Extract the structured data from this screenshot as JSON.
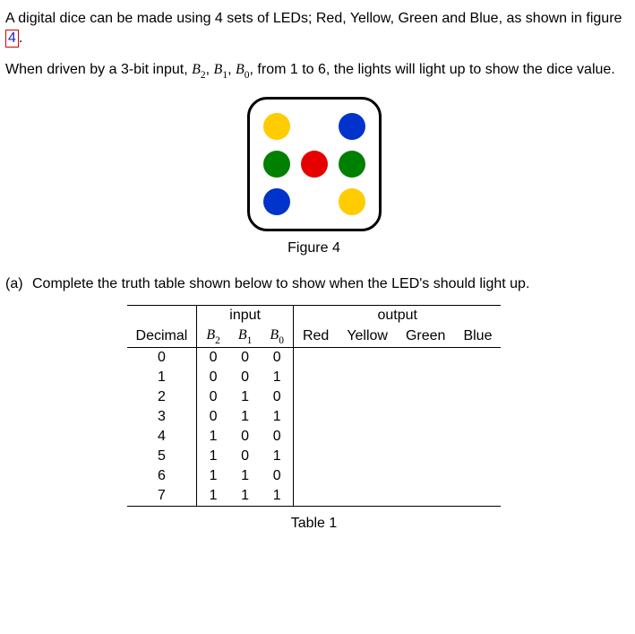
{
  "intro": {
    "p1_a": "A digital dice can be made using 4 sets of LEDs; Red, Yellow, Green and Blue, as shown in figure ",
    "fig_ref": "4",
    "p1_b": ".",
    "p2_a": "When driven by a 3-bit input, ",
    "bit2": "B",
    "bit2_sub": "2",
    "comma1": ", ",
    "bit1": "B",
    "bit1_sub": "1",
    "comma2": ", ",
    "bit0": "B",
    "bit0_sub": "0",
    "p2_b": ", from 1 to 6, the lights will light up to show the dice value."
  },
  "figure": {
    "caption": "Figure 4",
    "colors": {
      "red": "#e60000",
      "yellow": "#ffcc00",
      "green": "#008000",
      "blue": "#0033cc"
    },
    "layout": [
      [
        "yellow",
        null,
        "blue"
      ],
      [
        "green",
        "red",
        "green"
      ],
      [
        "blue",
        null,
        "yellow"
      ]
    ]
  },
  "question": {
    "label": "(a)",
    "text": "Complete the truth table shown below to show when the LED's should light up."
  },
  "table": {
    "caption": "Table 1",
    "group_headers": {
      "input": "input",
      "output": "output"
    },
    "columns": {
      "decimal": "Decimal",
      "b2": "B",
      "b2_sub": "2",
      "b1": "B",
      "b1_sub": "1",
      "b0": "B",
      "b0_sub": "0",
      "red": "Red",
      "yellow": "Yellow",
      "green": "Green",
      "blue": "Blue"
    },
    "rows": [
      {
        "dec": "0",
        "b2": "0",
        "b1": "0",
        "b0": "0",
        "red": "",
        "yellow": "",
        "green": "",
        "blue": ""
      },
      {
        "dec": "1",
        "b2": "0",
        "b1": "0",
        "b0": "1",
        "red": "",
        "yellow": "",
        "green": "",
        "blue": ""
      },
      {
        "dec": "2",
        "b2": "0",
        "b1": "1",
        "b0": "0",
        "red": "",
        "yellow": "",
        "green": "",
        "blue": ""
      },
      {
        "dec": "3",
        "b2": "0",
        "b1": "1",
        "b0": "1",
        "red": "",
        "yellow": "",
        "green": "",
        "blue": ""
      },
      {
        "dec": "4",
        "b2": "1",
        "b1": "0",
        "b0": "0",
        "red": "",
        "yellow": "",
        "green": "",
        "blue": ""
      },
      {
        "dec": "5",
        "b2": "1",
        "b1": "0",
        "b0": "1",
        "red": "",
        "yellow": "",
        "green": "",
        "blue": ""
      },
      {
        "dec": "6",
        "b2": "1",
        "b1": "1",
        "b0": "0",
        "red": "",
        "yellow": "",
        "green": "",
        "blue": ""
      },
      {
        "dec": "7",
        "b2": "1",
        "b1": "1",
        "b0": "1",
        "red": "",
        "yellow": "",
        "green": "",
        "blue": ""
      }
    ]
  }
}
